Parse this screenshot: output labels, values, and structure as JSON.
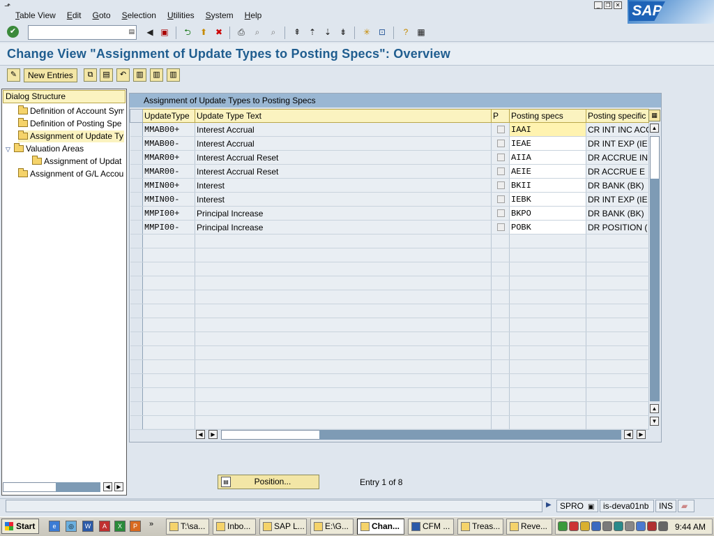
{
  "menu": [
    "Table View",
    "Edit",
    "Goto",
    "Selection",
    "Utilities",
    "System",
    "Help"
  ],
  "logo": {
    "text": "SAP"
  },
  "command_field": {
    "value": "",
    "placeholder": ""
  },
  "page_title": "Change View \"Assignment of Update Types to Posting Specs\": Overview",
  "app_toolbar": {
    "new_entries_label": "New Entries"
  },
  "dialog_structure": {
    "header": "Dialog Structure",
    "items": [
      {
        "label": "Definition of Account Sym"
      },
      {
        "label": "Definition of Posting Spe"
      },
      {
        "label": "Assignment of Update Ty"
      },
      {
        "label": "Valuation Areas"
      },
      {
        "label": "Assignment of Updat"
      },
      {
        "label": "Assignment of G/L Accou"
      }
    ]
  },
  "table": {
    "title": "Assignment of Update Types to Posting Specs",
    "columns": [
      "UpdateType",
      "Update Type Text",
      "P",
      "Posting specs",
      "Posting specific"
    ],
    "rows": [
      {
        "update_type": "MMAB00+",
        "text": "Interest Accrual",
        "spec": "IAAI",
        "spec_text": "CR INT INC ACC"
      },
      {
        "update_type": "MMAB00-",
        "text": "Interest Accrual",
        "spec": "IEAE",
        "spec_text": "DR INT EXP (IE"
      },
      {
        "update_type": "MMAR00+",
        "text": "Interest Accrual Reset",
        "spec": "AIIA",
        "spec_text": "DR ACCRUE IN"
      },
      {
        "update_type": "MMAR00-",
        "text": "Interest Accrual Reset",
        "spec": "AEIE",
        "spec_text": "DR ACCRUE E"
      },
      {
        "update_type": "MMIN00+",
        "text": "Interest",
        "spec": "BKII",
        "spec_text": "DR BANK (BK)"
      },
      {
        "update_type": "MMIN00-",
        "text": "Interest",
        "spec": "IEBK",
        "spec_text": "DR INT EXP (IE"
      },
      {
        "update_type": "MMPI00+",
        "text": "Principal Increase",
        "spec": "BKPO",
        "spec_text": "DR BANK (BK)"
      },
      {
        "update_type": "MMPI00-",
        "text": "Principal Increase",
        "spec": "POBK",
        "spec_text": "DR POSITION ("
      }
    ],
    "empty_rows": 14
  },
  "position_button": {
    "label": "Position..."
  },
  "entry_count": "Entry 1 of 8",
  "status": {
    "transaction": "SPRO",
    "server": "is-deva01nb",
    "mode": "INS"
  },
  "taskbar": {
    "start": "Start",
    "tasks": [
      {
        "label": "T:\\sa..."
      },
      {
        "label": "Inbo..."
      },
      {
        "label": "SAP L..."
      },
      {
        "label": "E:\\G..."
      },
      {
        "label": "Chan...",
        "active": true
      },
      {
        "label": "CFM ..."
      },
      {
        "label": "Treas..."
      },
      {
        "label": "Reve..."
      }
    ],
    "clock": "9:44 AM"
  }
}
